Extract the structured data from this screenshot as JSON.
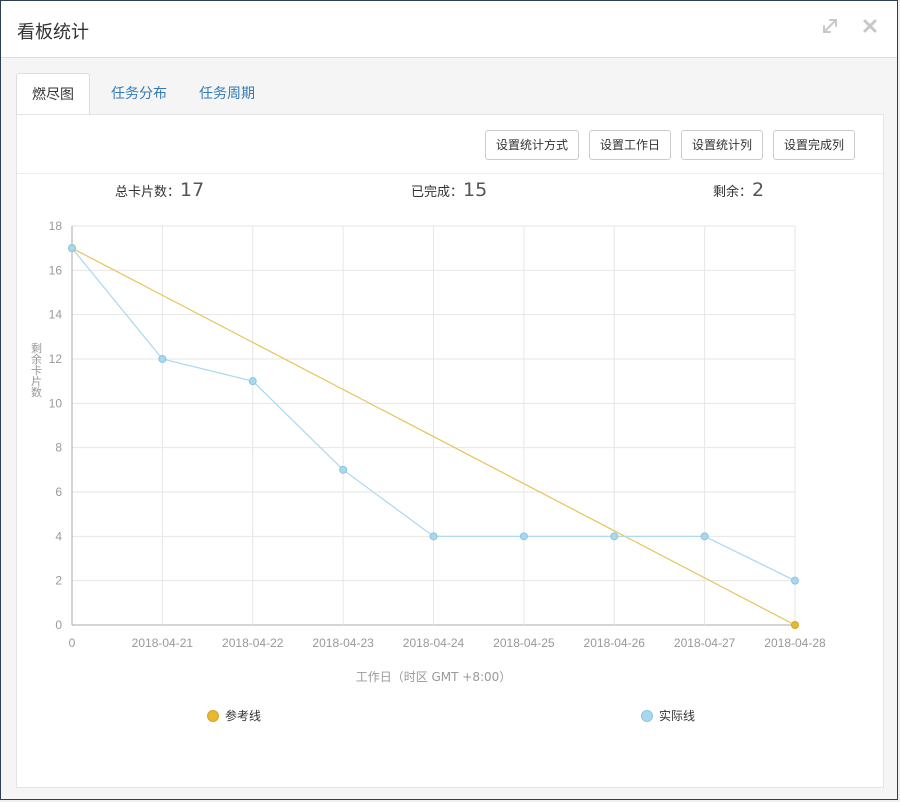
{
  "dialog": {
    "title": "看板统计",
    "expand_icon": "expand-icon",
    "close_icon": "close-icon"
  },
  "tabs": [
    {
      "label": "燃尽图",
      "active": true
    },
    {
      "label": "任务分布",
      "active": false
    },
    {
      "label": "任务周期",
      "active": false
    }
  ],
  "toolbar": {
    "set_stat_mode": "设置统计方式",
    "set_workdays": "设置工作日",
    "set_stat_columns": "设置统计列",
    "set_done_columns": "设置完成列"
  },
  "stats": {
    "total_label": "总卡片数：",
    "total": "17",
    "done_label": "已完成：",
    "done": "15",
    "remaining_label": "剩余：",
    "remaining": "2"
  },
  "colors": {
    "reference": "#e8c35a",
    "actual": "#a9d8ee",
    "grid": "#e6e6e6"
  },
  "chart_data": {
    "type": "line",
    "categories": [
      "0",
      "2018-04-21",
      "2018-04-22",
      "2018-04-23",
      "2018-04-24",
      "2018-04-25",
      "2018-04-26",
      "2018-04-27",
      "2018-04-28"
    ],
    "series": [
      {
        "name": "参考线",
        "values": [
          17,
          14.875,
          12.75,
          10.625,
          8.5,
          6.375,
          4.25,
          2.125,
          0
        ]
      },
      {
        "name": "实际线",
        "values": [
          17,
          12,
          11,
          7,
          4,
          4,
          4,
          4,
          2
        ]
      }
    ],
    "xlabel": "工作日（时区 GMT +8:00）",
    "ylabel": "剩余卡片数",
    "ylim": [
      0,
      18
    ],
    "yticks": [
      "0",
      "2",
      "4",
      "6",
      "8",
      "10",
      "12",
      "14",
      "16",
      "18"
    ],
    "grid": true,
    "legend": "bottom"
  }
}
